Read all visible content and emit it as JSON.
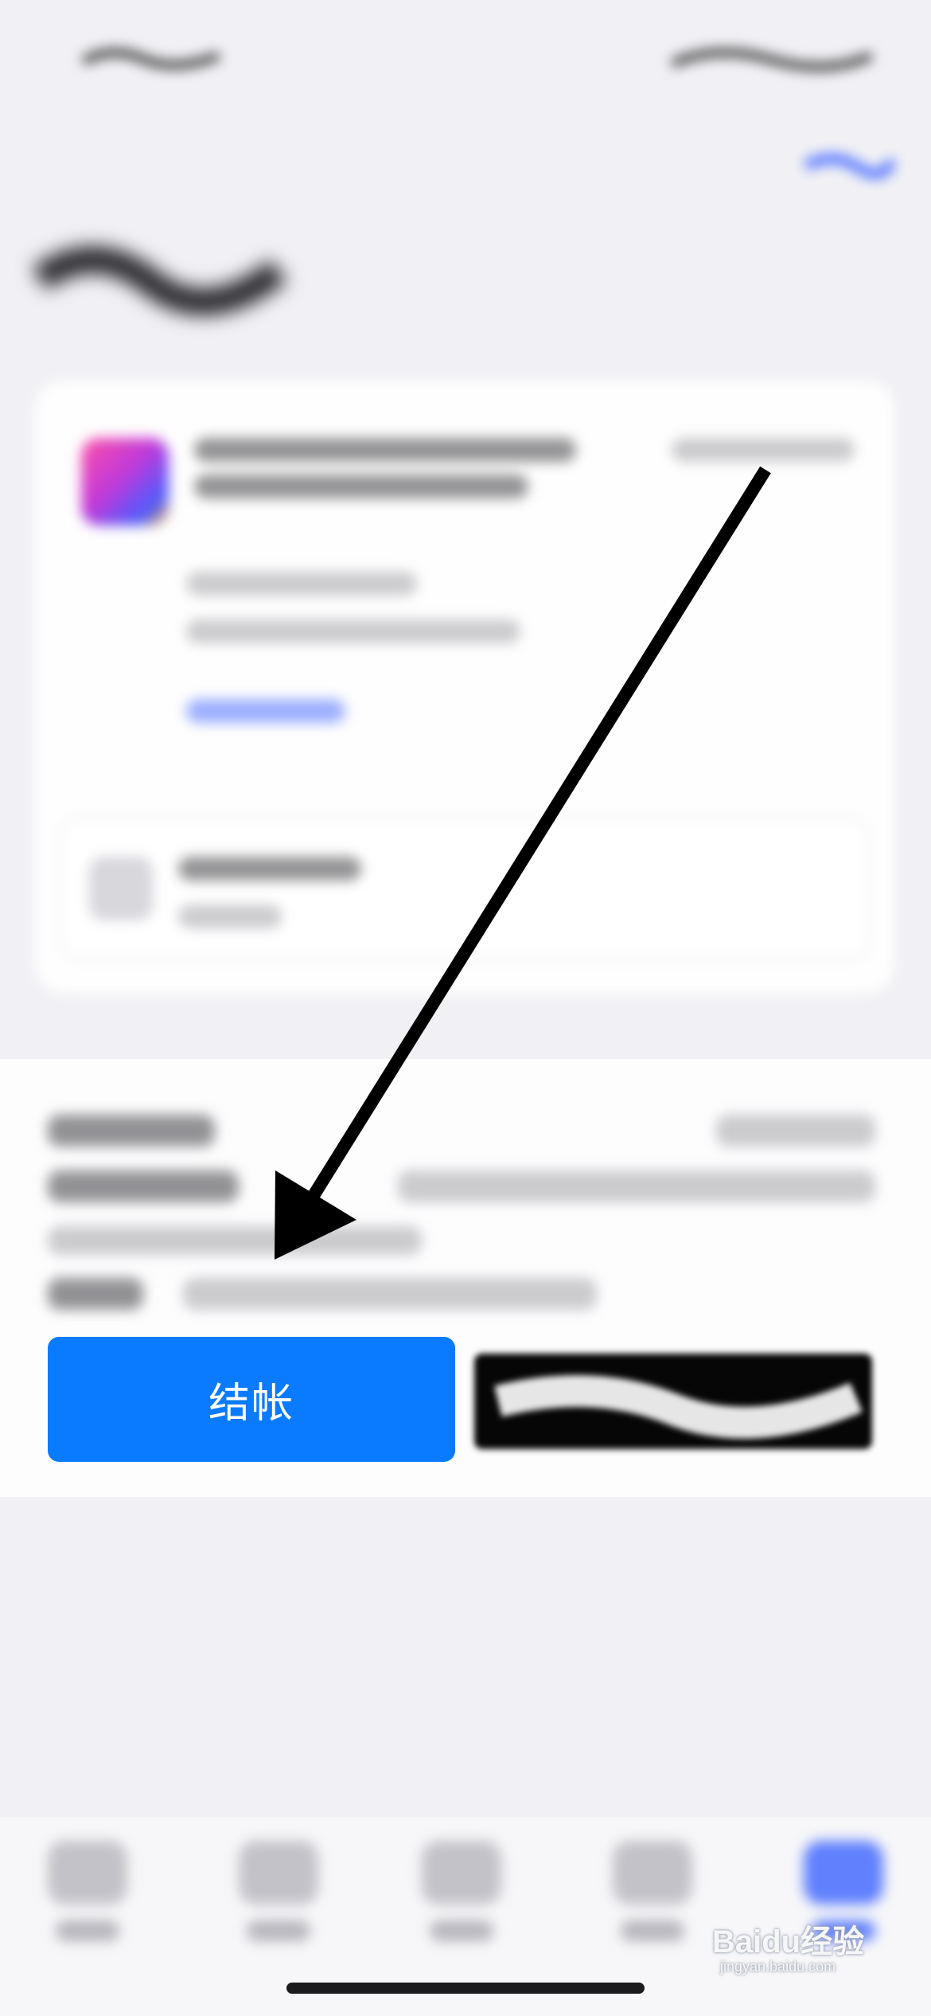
{
  "checkout": {
    "label": "结帐",
    "color": "#0a7bfe"
  },
  "watermark": {
    "main": "Baidu经验",
    "sub": "jingyan.baidu.com"
  },
  "tabbar": {
    "tab_count": 5,
    "active_index": 4
  },
  "annotation": {
    "type": "arrow",
    "color": "#000000",
    "points_to": "checkout-button"
  }
}
